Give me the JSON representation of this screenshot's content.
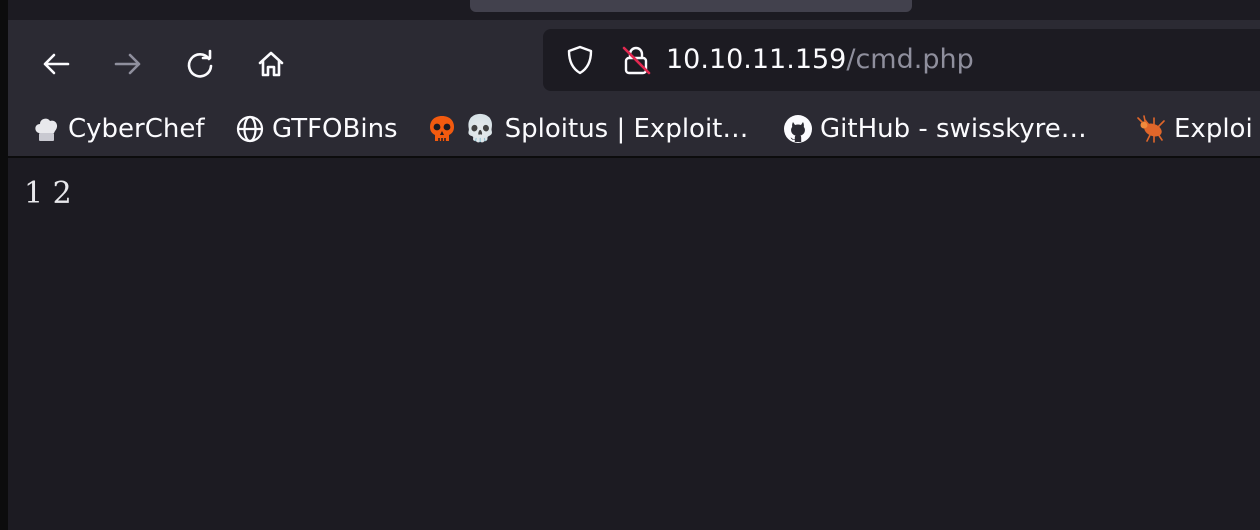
{
  "browser": {
    "url": {
      "host": "10.10.11.159",
      "path": "/cmd.php"
    }
  },
  "bookmarks": [
    {
      "label": "CyberChef",
      "icon": "chef-hat-icon"
    },
    {
      "label": "GTFOBins",
      "icon": "globe-icon"
    },
    {
      "label": "💀 Sploitus | Exploit…",
      "icon": "skull-icon"
    },
    {
      "label": "GitHub - swisskyre…",
      "icon": "github-icon"
    },
    {
      "label": "Exploi",
      "icon": "bug-icon"
    }
  ],
  "page": {
    "body_text": "1 2"
  },
  "colors": {
    "toolbar": "#2b2a33",
    "content_bg": "#1c1b22",
    "text": "#fbfbfe",
    "muted": "#8f8f9d",
    "skull_orange": "#f25a0f"
  }
}
